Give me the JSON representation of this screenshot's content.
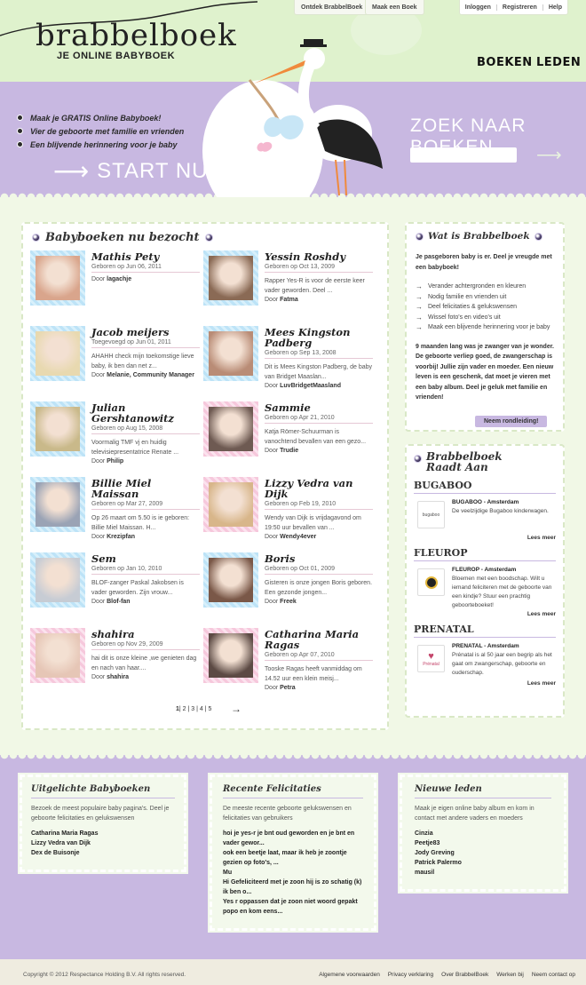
{
  "brand": {
    "logo": "brabbelboek",
    "tagline": "JE ONLINE BABYBOEK"
  },
  "top_tabs": {
    "ontdek": "Ontdek BrabbelBoek",
    "maak": "Maak een Boek"
  },
  "account_nav": [
    "Inloggen",
    "Registreren",
    "Help"
  ],
  "main_nav": {
    "boeken": "BOEKEN",
    "leden": "LEDEN"
  },
  "hero": {
    "bullets": [
      "Maak je GRATIS Online Babyboek!",
      "Vier de geboorte met familie en vrienden",
      "Een blijvende herinnering voor je baby"
    ],
    "cta": "START NU!",
    "search_title": "ZOEK NAAR BOEKEN",
    "search_placeholder": ""
  },
  "recent": {
    "title": "Babyboeken nu bezocht",
    "items": [
      {
        "name": "Mathis Pety",
        "meta": "Geboren op Jun 06, 2011",
        "desc": "",
        "by": "lagachje",
        "frame": "blue",
        "photo": "#d9a58c"
      },
      {
        "name": "Yessin Roshdy",
        "meta": "Geboren op Oct 13, 2009",
        "desc": "Rapper Yes-R is voor de eerste keer vader geworden. Deel ...",
        "by": "Fatma",
        "frame": "blue",
        "photo": "#8a6a55"
      },
      {
        "name": "Jacob meijers",
        "meta": "Toegevoegd op Jun 01, 2011",
        "desc": "AHAHH check mijn toekomstige lieve baby, ik ben dan net z...",
        "by": "Melanie, Community Manager",
        "frame": "blue",
        "photo": "#e8d9b0"
      },
      {
        "name": "Mees Kingston Padberg",
        "meta": "Geboren op Sep 13, 2008",
        "desc": "Dit is Mees Kingston Padberg, de baby van Bridget Maaslan...",
        "by": "LuvBridgetMaasland",
        "frame": "blue",
        "photo": "#b98c76"
      },
      {
        "name": "Julian Gershtanowitz",
        "meta": "Geboren op Aug 15, 2008",
        "desc": "Voormalig TMF vj en huidig televisiepresentatrice Renate ...",
        "by": "Philip",
        "frame": "blue",
        "photo": "#c9b98a"
      },
      {
        "name": "Sammie",
        "meta": "Geboren op Apr 21, 2010",
        "desc": "Katja Römer-Schuurman is vanochtend bevallen van een gezo...",
        "by": "Trudie",
        "frame": "pink",
        "photo": "#6e5a52"
      },
      {
        "name": "Billie Miel Maissan",
        "meta": "Geboren op Mar 27, 2009",
        "desc": "Op 26 maart om 5.50 is ie geboren: Billie Miel Maissan. H...",
        "by": "Krezipfan",
        "frame": "blue",
        "photo": "#9aa3b5"
      },
      {
        "name": "Lizzy Vedra van Dijk",
        "meta": "Geboren op Feb 19, 2010",
        "desc": "Wendy van Dijk is vrijdagavond om 19:50 uur bevallen van ...",
        "by": "Wendy4ever",
        "frame": "pink",
        "photo": "#d8b68a"
      },
      {
        "name": "Sem",
        "meta": "Geboren op Jan 10, 2010",
        "desc": "BLOF-zanger Paskal Jakobsen is vader geworden. Zijn vrouw...",
        "by": "Blof-fan",
        "frame": "blue",
        "photo": "#c7ccd4"
      },
      {
        "name": "Boris",
        "meta": "Geboren op Oct 01, 2009",
        "desc": "Gisteren is onze jongen Boris geboren. Een gezonde jongen...",
        "by": "Freek",
        "frame": "blue",
        "photo": "#7a5848"
      },
      {
        "name": "shahira",
        "meta": "Geboren op Nov 29, 2009",
        "desc": "hai dit is onze kleine ,we genieten dag en nach van haar....",
        "by": "shahira",
        "frame": "pink",
        "photo": "#e6c6b6"
      },
      {
        "name": "Catharina Maria Ragas",
        "meta": "Geboren op Apr 07, 2010",
        "desc": "Tooske Ragas heeft vanmiddag om 14.52 uur een klein meisj...",
        "by": "Petra",
        "frame": "pink",
        "photo": "#5c4a44"
      }
    ],
    "pager": {
      "current": "1",
      "rest": "| 2 | 3 | 4 | 5",
      "next": "→"
    }
  },
  "wat": {
    "title": "Wat is Brabbelboek",
    "intro": "Je pasgeboren baby is er. Deel je vreugde met een babyboek!",
    "points": [
      "Verander achtergronden en kleuren",
      "Nodig familie en vrienden uit",
      "Deel felicitaties & gelukswensen",
      "Wissel foto's en video's uit",
      "Maak een blijvende herinnering voor je baby"
    ],
    "body": "9 maanden lang was je zwanger van je wonder. De geboorte verliep goed, de zwangerschap is voorbij! Jullie zijn vader en moeder. Een nieuw leven is een geschenk, dat moet je vieren met een baby album. Deel je geluk met familie en vrienden!",
    "button": "Neem rondleiding!"
  },
  "raadt": {
    "title": "Brabbelboek Raadt Aan",
    "brands": [
      {
        "heading": "BUGABOO",
        "logo": "bugaboo",
        "name": "BUGABOO - Amsterdam",
        "text": "De veelzijdige Bugaboo kinderwagen.",
        "more": "Lees meer"
      },
      {
        "heading": "FLEUROP",
        "logo": "",
        "name": "FLEUROP - Amsterdam",
        "text": "Bloemen met een boodschap. Wilt u iemand feliciteren met de geboorte van een kindje? Stuur een prachtig geboorteboeket!",
        "more": "Lees meer"
      },
      {
        "heading": "PRENATAL",
        "logo": "Prénatal",
        "name": "PRENATAL - Amsterdam",
        "text": "Prénatal is al 50 jaar een begrip als het gaat om zwangerschap, geboorte en ouderschap.",
        "more": "Lees meer"
      }
    ]
  },
  "footer_boxes": {
    "uitgelicht": {
      "title": "Uitgelichte Babyboeken",
      "intro": "Bezoek de meest populaire baby pagina's. Deel je geboorte felicitaties en gelukswensen",
      "links": [
        "Catharina Maria Ragas",
        "Lizzy Vedra van Dijk",
        "Dex de Buisonje"
      ]
    },
    "felicitaties": {
      "title": "Recente Felicitaties",
      "intro": "De meeste recente geboorte gelukswensen en felicitaties van gebruikers",
      "links": [
        "hoi je yes-r je bnt oud geworden en je bnt en vader gewor...",
        "ook een beetje laat, maar ik heb je zoontje gezien op foto's, ...",
        "Mu",
        "Hi Gefeliciteerd met je zoon hij is zo schatig (k) ik ben o...",
        "Yes r oppassen dat je zoon niet woord gepakt popo en kom eens..."
      ]
    },
    "leden": {
      "title": "Nieuwe leden",
      "intro": "Maak je eigen online baby album en kom in contact met andere vaders en moeders",
      "links": [
        "Cinzia",
        "Peetje83",
        "Jody Greving",
        "Patrick Palermo",
        "mausil"
      ]
    }
  },
  "copyright": "Copyright © 2012 Respectance Holding B.V. All rights reserved.",
  "footer_links": [
    "Algemene voorwaarden",
    "Privacy verklaring",
    "Over BrabbelBoek",
    "Werken bij",
    "Neem contact op"
  ]
}
